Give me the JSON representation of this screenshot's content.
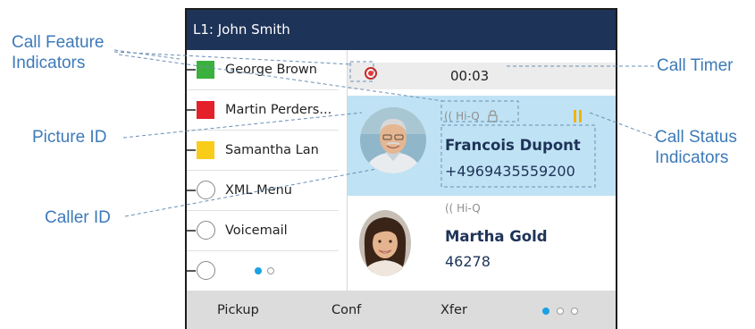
{
  "callouts": {
    "call_feature_indicators": [
      "Call Feature",
      "Indicators"
    ],
    "picture_id": "Picture ID",
    "caller_id": "Caller ID",
    "call_timer": "Call Timer",
    "call_status_indicators": [
      "Call Status",
      "Indicators"
    ]
  },
  "phone": {
    "title": "L1: John Smith",
    "line_keys": [
      {
        "label": "George Brown",
        "indicator": "square",
        "color": "#3cb03c"
      },
      {
        "label": "Martin Perders...",
        "indicator": "square",
        "color": "#e4202a"
      },
      {
        "label": "Samantha Lan",
        "indicator": "square",
        "color": "#f9cc1a"
      },
      {
        "label": "XML Menu",
        "indicator": "circle"
      },
      {
        "label": "Voicemail",
        "indicator": "circle"
      },
      {
        "label": "",
        "indicator": "circle"
      }
    ],
    "sidebar_page": {
      "count": 2,
      "active": 1
    },
    "timer": "00:03",
    "recording_color": "#e53935",
    "active_call": {
      "audio_badge": "(( Hi-Q",
      "lock_icon": "padlock-icon",
      "status_icon": "pause-icon",
      "name": "Francois Dupont",
      "number": "+4969435559200",
      "highlight_color": "#bfe3f4"
    },
    "held_call": {
      "audio_badge": "(( Hi-Q",
      "name": "Martha Gold",
      "number": "46278"
    },
    "softkeys": [
      "Pickup",
      "Conf",
      "Xfer"
    ],
    "softkey_page": {
      "count": 3,
      "active": 1
    },
    "accent_color": "#1ba1e2",
    "header_color": "#1e3358"
  }
}
